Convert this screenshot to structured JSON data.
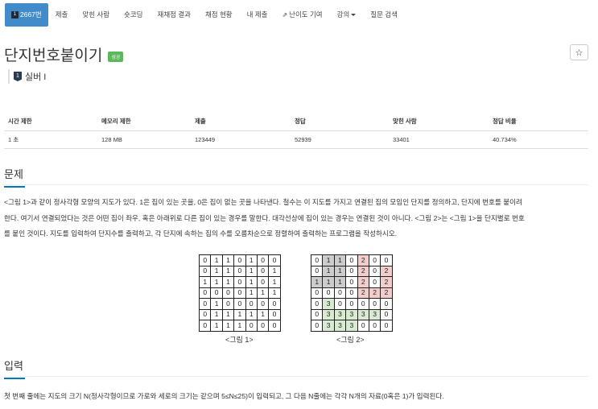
{
  "nav": {
    "items": [
      {
        "label": "2667번",
        "tier": "1"
      },
      {
        "label": "제출"
      },
      {
        "label": "맞힌 사람"
      },
      {
        "label": "숏코딩"
      },
      {
        "label": "재채점 결과"
      },
      {
        "label": "채점 현황"
      },
      {
        "label": "내 제출"
      },
      {
        "label": "난이도 기여"
      },
      {
        "label": "강의"
      },
      {
        "label": "질문 검색"
      }
    ]
  },
  "problem": {
    "title": "단지번호붙이기",
    "badge": "성공",
    "tier_label": "실버 I",
    "tier_icon": "1"
  },
  "info": {
    "headers": [
      "시간 제한",
      "메모리 제한",
      "제출",
      "정답",
      "맞힌 사람",
      "정답 비율"
    ],
    "values": [
      "1 초",
      "128 MB",
      "123449",
      "52939",
      "33401",
      "40.734%"
    ]
  },
  "sections": {
    "problem_heading": "문제",
    "problem_text_1": "<그림 1>과 같이 정사각형 모양의 지도가 있다. 1은 집이 있는 곳을, 0은 집이 없는 곳을 나타낸다. 철수는 이 지도를 가지고 연결된 집의 모임인 단지를 정의하고, 단지에 번호를 붙이려",
    "problem_text_2": "한다. 여기서 연결되었다는 것은 어떤 집이 좌우, 혹은 아래위로 다른 집이 있는 경우를 말한다. 대각선상에 집이 있는 경우는 연결된 것이 아니다. <그림 2>는 <그림 1>을 단지별로 번호",
    "problem_text_3": "를 붙인 것이다. 지도를 입력하여 단지수를 출력하고, 각 단지에 속하는 집의 수를 오름차순으로 정렬하여 출력하는 프로그램을 작성하시오.",
    "input_heading": "입력",
    "input_text": "첫 번째 줄에는 지도의 크기 N(정사각형이므로 가로와 세로의 크기는 같으며 5≤N≤25)이 입력되고, 그 다음 N줄에는 각각 N개의 자료(0혹은 1)가 입력된다."
  },
  "figure1": {
    "caption": "<그림 1>",
    "rows": [
      [
        "0",
        "1",
        "1",
        "0",
        "1",
        "0",
        "0"
      ],
      [
        "0",
        "1",
        "1",
        "0",
        "1",
        "0",
        "1"
      ],
      [
        "1",
        "1",
        "1",
        "0",
        "1",
        "0",
        "1"
      ],
      [
        "0",
        "0",
        "0",
        "0",
        "1",
        "1",
        "1"
      ],
      [
        "0",
        "1",
        "0",
        "0",
        "0",
        "0",
        "0"
      ],
      [
        "0",
        "1",
        "1",
        "1",
        "1",
        "1",
        "0"
      ],
      [
        "0",
        "1",
        "1",
        "1",
        "0",
        "0",
        "0"
      ]
    ]
  },
  "figure2": {
    "caption": "<그림 2>",
    "rows": [
      [
        "0",
        "1",
        "1",
        "0",
        "2",
        "0",
        "0"
      ],
      [
        "0",
        "1",
        "1",
        "0",
        "2",
        "0",
        "2"
      ],
      [
        "1",
        "1",
        "1",
        "0",
        "2",
        "0",
        "2"
      ],
      [
        "0",
        "0",
        "0",
        "0",
        "2",
        "2",
        "2"
      ],
      [
        "0",
        "3",
        "0",
        "0",
        "0",
        "0",
        "0"
      ],
      [
        "0",
        "3",
        "3",
        "3",
        "3",
        "3",
        "0"
      ],
      [
        "0",
        "3",
        "3",
        "3",
        "0",
        "0",
        "0"
      ]
    ],
    "colors": {
      "group1": "#cccccc",
      "group2": "#f4cccc",
      "group3": "#d9ead3"
    }
  },
  "icons": {
    "star": "star-icon",
    "external": "external-link-icon",
    "caret": "caret-down-icon"
  }
}
